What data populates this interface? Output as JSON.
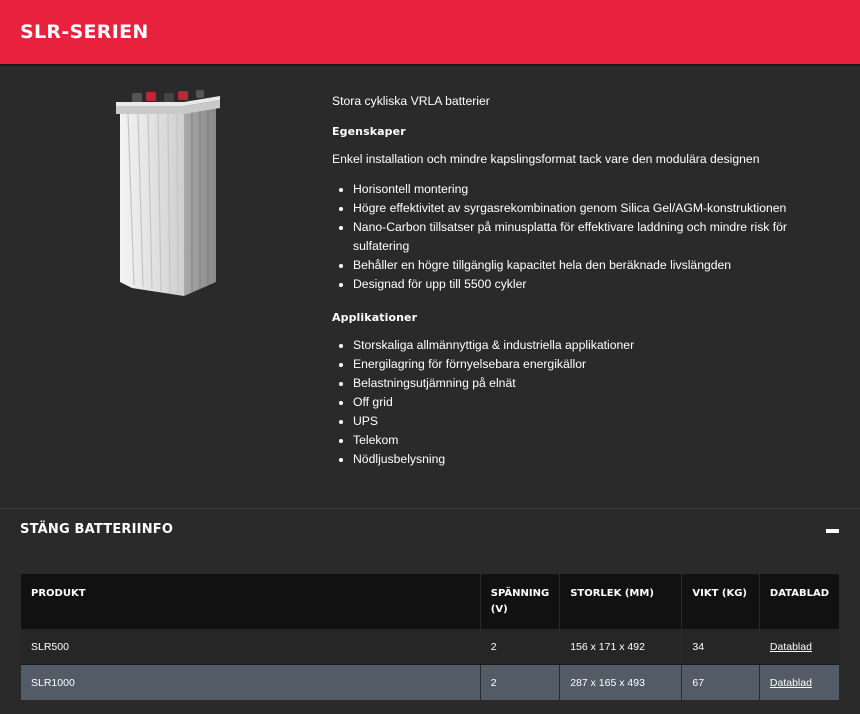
{
  "header": {
    "title": "SLR-SERIEN"
  },
  "product": {
    "image_icon": "battery-product-image",
    "intro": "Stora cykliska VRLA batterier",
    "features_heading": "Egenskaper",
    "features_lead": "Enkel installation och mindre kapslingsformat tack vare den modulära designen",
    "features": [
      "Horisontell montering",
      "Högre effektivitet av syrgasrekombination genom Silica Gel/AGM-konstruktionen",
      "Nano-Carbon tillsatser på minusplatta för effektivare laddning och mindre risk för sulfatering",
      "Behåller en högre tillgänglig kapacitet hela den beräknade livslängden",
      "Designad för upp till 5500 cykler"
    ],
    "applications_heading": "Applikationer",
    "applications": [
      "Storskaliga allmännyttiga & industriella applikationer",
      "Energilagring för förnyelsebara energikällor",
      "Belastningsutjämning på elnät",
      "Off grid",
      "UPS",
      "Telekom",
      "Nödljusbelysning"
    ]
  },
  "battery_info": {
    "toggle_label": "STÄNG BATTERIINFO",
    "toggle_icon": "minus-icon",
    "columns": [
      "PRODUKT",
      "SPÄNNING (V)",
      "STORLEK (MM)",
      "VIKT (KG)",
      "DATABLAD"
    ],
    "rows": [
      {
        "product": "SLR500",
        "voltage": "2",
        "size": "156 x 171 x 492",
        "weight": "34",
        "datasheet": "Datablad"
      },
      {
        "product": "SLR1000",
        "voltage": "2",
        "size": "287 x 165 x 493",
        "weight": "67",
        "datasheet": "Datablad"
      }
    ]
  },
  "colors": {
    "header_red": "#e8213c",
    "page_bg": "#2a2a2a",
    "table_header_bg": "#111111",
    "row_highlight": "#525b66"
  }
}
